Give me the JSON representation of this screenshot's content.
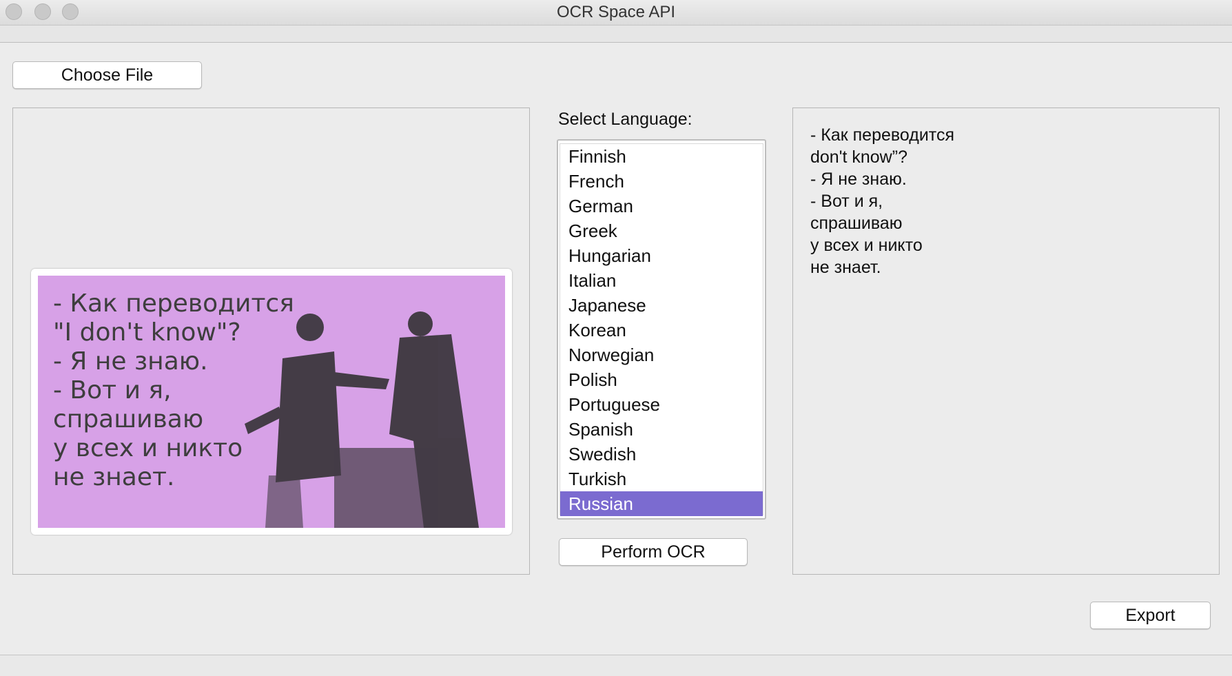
{
  "window": {
    "title": "OCR Space API"
  },
  "buttons": {
    "choose_file": "Choose File",
    "perform_ocr": "Perform OCR",
    "export": "Export"
  },
  "language": {
    "label": "Select Language:",
    "options": [
      "Finnish",
      "French",
      "German",
      "Greek",
      "Hungarian",
      "Italian",
      "Japanese",
      "Korean",
      "Norwegian",
      "Polish",
      "Portuguese",
      "Spanish",
      "Swedish",
      "Turkish",
      "Russian"
    ],
    "selected": "Russian"
  },
  "image": {
    "caption": "- Как переводится\n\"I don't know\"?\n- Я не знаю.\n- Вот и я,\nспрашиваю\nу всех и никто\nне знает.",
    "background_color": "#d7a1e7"
  },
  "result": {
    "text": "- Как переводится\ndon't know”?\n- Я не знаю.\n- Вот и я,\nспрашиваю\nу всех и никто\nне знает."
  },
  "colors": {
    "selection": "#7b6bd0",
    "window_bg": "#ececec"
  }
}
